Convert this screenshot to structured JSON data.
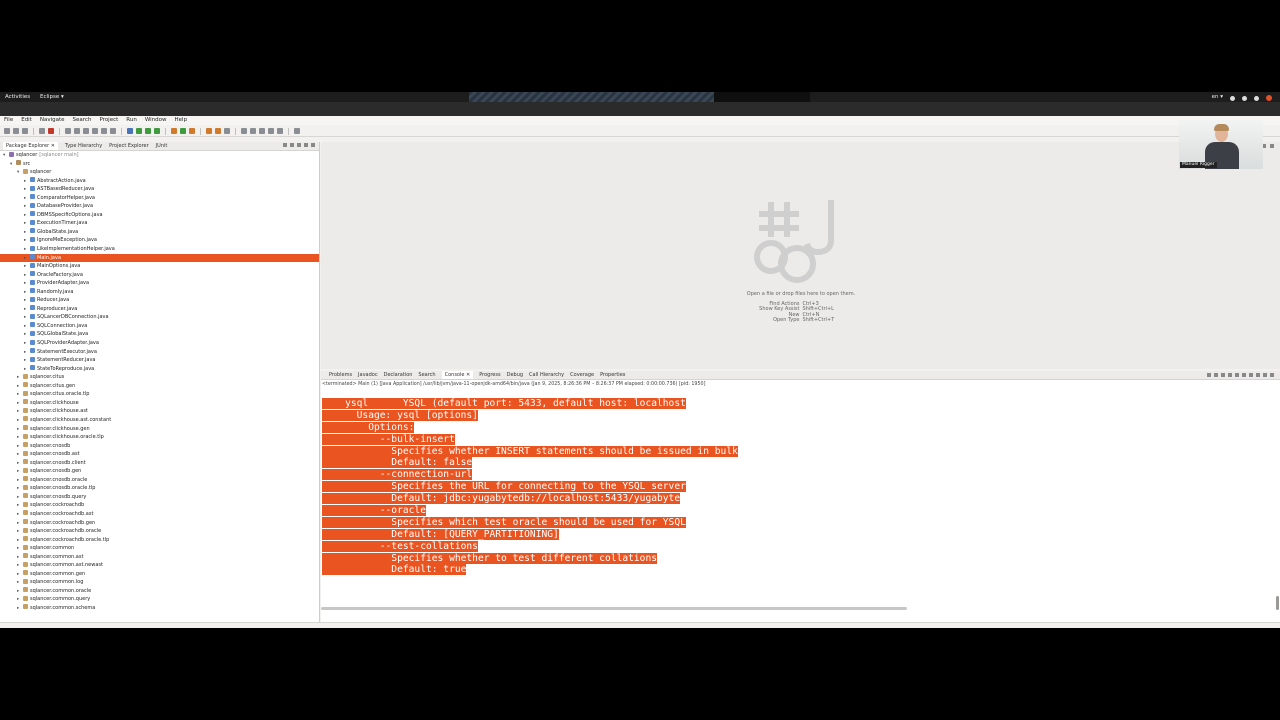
{
  "system_bar": {
    "activities": "Activities",
    "app_menu": "Eclipse ▾",
    "locale": "en ▾"
  },
  "menu": [
    "File",
    "Edit",
    "Navigate",
    "Search",
    "Project",
    "Run",
    "Window",
    "Help"
  ],
  "left_tabs": [
    "Package Explorer ✕",
    "Type Hierarchy",
    "Project Explorer",
    "JUnit"
  ],
  "tree": [
    {
      "indent": 0,
      "arrow": "▾",
      "icon": "proj",
      "label": "sqlancer",
      "suffix": "[sqlancer main]"
    },
    {
      "indent": 1,
      "arrow": "▾",
      "icon": "src",
      "label": "src"
    },
    {
      "indent": 2,
      "arrow": "▾",
      "icon": "pkg",
      "label": "sqlancer"
    },
    {
      "indent": 3,
      "arrow": "▸",
      "icon": "java",
      "label": "AbstractAction.java"
    },
    {
      "indent": 3,
      "arrow": "▸",
      "icon": "java",
      "label": "ASTBasedReducer.java"
    },
    {
      "indent": 3,
      "arrow": "▸",
      "icon": "java",
      "label": "ComparatorHelper.java"
    },
    {
      "indent": 3,
      "arrow": "▸",
      "icon": "java",
      "label": "DatabaseProvider.java"
    },
    {
      "indent": 3,
      "arrow": "▸",
      "icon": "java",
      "label": "DBMSSpecificOptions.java"
    },
    {
      "indent": 3,
      "arrow": "▸",
      "icon": "java",
      "label": "ExecutionTimer.java"
    },
    {
      "indent": 3,
      "arrow": "▸",
      "icon": "java",
      "label": "GlobalState.java"
    },
    {
      "indent": 3,
      "arrow": "▸",
      "icon": "java",
      "label": "IgnoreMeException.java"
    },
    {
      "indent": 3,
      "arrow": "▸",
      "icon": "java",
      "label": "LikeImplementationHelper.java"
    },
    {
      "indent": 3,
      "arrow": "▸",
      "icon": "java",
      "label": "Main.java",
      "selected": true
    },
    {
      "indent": 3,
      "arrow": "▸",
      "icon": "java",
      "label": "MainOptions.java"
    },
    {
      "indent": 3,
      "arrow": "▸",
      "icon": "java",
      "label": "OracleFactory.java"
    },
    {
      "indent": 3,
      "arrow": "▸",
      "icon": "java",
      "label": "ProviderAdapter.java"
    },
    {
      "indent": 3,
      "arrow": "▸",
      "icon": "java",
      "label": "Randomly.java"
    },
    {
      "indent": 3,
      "arrow": "▸",
      "icon": "java",
      "label": "Reducer.java"
    },
    {
      "indent": 3,
      "arrow": "▸",
      "icon": "java",
      "label": "Reproducer.java"
    },
    {
      "indent": 3,
      "arrow": "▸",
      "icon": "java",
      "label": "SQLancerDBConnection.java"
    },
    {
      "indent": 3,
      "arrow": "▸",
      "icon": "java",
      "label": "SQLConnection.java"
    },
    {
      "indent": 3,
      "arrow": "▸",
      "icon": "java",
      "label": "SQLGlobalState.java"
    },
    {
      "indent": 3,
      "arrow": "▸",
      "icon": "java",
      "label": "SQLProviderAdapter.java"
    },
    {
      "indent": 3,
      "arrow": "▸",
      "icon": "java",
      "label": "StatementExecutor.java"
    },
    {
      "indent": 3,
      "arrow": "▸",
      "icon": "java",
      "label": "StatementReducer.java"
    },
    {
      "indent": 3,
      "arrow": "▸",
      "icon": "java",
      "label": "StateToReproduce.java"
    },
    {
      "indent": 2,
      "arrow": "▸",
      "icon": "pkg",
      "label": "sqlancer.citus"
    },
    {
      "indent": 2,
      "arrow": "▸",
      "icon": "pkg",
      "label": "sqlancer.citus.gen"
    },
    {
      "indent": 2,
      "arrow": "▸",
      "icon": "pkg",
      "label": "sqlancer.citus.oracle.tlp"
    },
    {
      "indent": 2,
      "arrow": "▸",
      "icon": "pkg",
      "label": "sqlancer.clickhouse"
    },
    {
      "indent": 2,
      "arrow": "▸",
      "icon": "pkg",
      "label": "sqlancer.clickhouse.ast"
    },
    {
      "indent": 2,
      "arrow": "▸",
      "icon": "pkg",
      "label": "sqlancer.clickhouse.ast.constant"
    },
    {
      "indent": 2,
      "arrow": "▸",
      "icon": "pkg",
      "label": "sqlancer.clickhouse.gen"
    },
    {
      "indent": 2,
      "arrow": "▸",
      "icon": "pkg",
      "label": "sqlancer.clickhouse.oracle.tlp"
    },
    {
      "indent": 2,
      "arrow": "▸",
      "icon": "pkg",
      "label": "sqlancer.cnosdb"
    },
    {
      "indent": 2,
      "arrow": "▸",
      "icon": "pkg",
      "label": "sqlancer.cnosdb.ast"
    },
    {
      "indent": 2,
      "arrow": "▸",
      "icon": "pkg",
      "label": "sqlancer.cnosdb.client"
    },
    {
      "indent": 2,
      "arrow": "▸",
      "icon": "pkg",
      "label": "sqlancer.cnosdb.gen"
    },
    {
      "indent": 2,
      "arrow": "▸",
      "icon": "pkg",
      "label": "sqlancer.cnosdb.oracle"
    },
    {
      "indent": 2,
      "arrow": "▸",
      "icon": "pkg",
      "label": "sqlancer.cnosdb.oracle.tlp"
    },
    {
      "indent": 2,
      "arrow": "▸",
      "icon": "pkg",
      "label": "sqlancer.cnosdb.query"
    },
    {
      "indent": 2,
      "arrow": "▸",
      "icon": "pkg",
      "label": "sqlancer.cockroachdb"
    },
    {
      "indent": 2,
      "arrow": "▸",
      "icon": "pkg",
      "label": "sqlancer.cockroachdb.ast"
    },
    {
      "indent": 2,
      "arrow": "▸",
      "icon": "pkg",
      "label": "sqlancer.cockroachdb.gen"
    },
    {
      "indent": 2,
      "arrow": "▸",
      "icon": "pkg",
      "label": "sqlancer.cockroachdb.oracle"
    },
    {
      "indent": 2,
      "arrow": "▸",
      "icon": "pkg",
      "label": "sqlancer.cockroachdb.oracle.tlp"
    },
    {
      "indent": 2,
      "arrow": "▸",
      "icon": "pkg",
      "label": "sqlancer.common"
    },
    {
      "indent": 2,
      "arrow": "▸",
      "icon": "pkg",
      "label": "sqlancer.common.ast"
    },
    {
      "indent": 2,
      "arrow": "▸",
      "icon": "pkg",
      "label": "sqlancer.common.ast.newast"
    },
    {
      "indent": 2,
      "arrow": "▸",
      "icon": "pkg",
      "label": "sqlancer.common.gen"
    },
    {
      "indent": 2,
      "arrow": "▸",
      "icon": "pkg",
      "label": "sqlancer.common.log"
    },
    {
      "indent": 2,
      "arrow": "▸",
      "icon": "pkg",
      "label": "sqlancer.common.oracle"
    },
    {
      "indent": 2,
      "arrow": "▸",
      "icon": "pkg",
      "label": "sqlancer.common.query"
    },
    {
      "indent": 2,
      "arrow": "▸",
      "icon": "pkg",
      "label": "sqlancer.common.schema"
    }
  ],
  "editor": {
    "hint_title": "Open a file or drop files here to open them.",
    "shortcuts": [
      {
        "action": "Find Actions",
        "keys": "Ctrl+3"
      },
      {
        "action": "Show Key Assist",
        "keys": "Shift+Ctrl+L"
      },
      {
        "action": "New",
        "keys": "Ctrl+N"
      },
      {
        "action": "Open Type",
        "keys": "Shift+Ctrl+T"
      }
    ]
  },
  "webcam": {
    "name": "Manuel Rigger"
  },
  "console_tabs": [
    "Problems",
    "Javadoc",
    "Declaration",
    "Search",
    "Console ✕",
    "Progress",
    "Debug",
    "Call Hierarchy",
    "Coverage",
    "Properties"
  ],
  "console_status": "<terminated> Main (1) [Java Application] /usr/lib/jvm/java-11-openjdk-amd64/bin/java  (Jan 9, 2025, 8:26:36 PM – 8:26:37 PM elapsed: 0:00:00.736) [pid: 1950]",
  "console_lines": [
    "    ysql      YSQL (default port: 5433, default host: localhost",
    "      Usage: ysql [options]",
    "        Options:",
    "          --bulk-insert",
    "            Specifies whether INSERT statements should be issued in bulk",
    "            Default: false",
    "          --connection-url",
    "            Specifies the URL for connecting to the YSQL server",
    "            Default: jdbc:yugabytedb://localhost:5433/yugabyte",
    "          --oracle",
    "            Specifies which test oracle should be used for YSQL",
    "            Default: [QUERY_PARTITIONING]",
    "          --test-collations",
    "            Specifies whether to test different collations",
    "            Default: true"
  ],
  "colors": {
    "accent": "#e95420"
  }
}
